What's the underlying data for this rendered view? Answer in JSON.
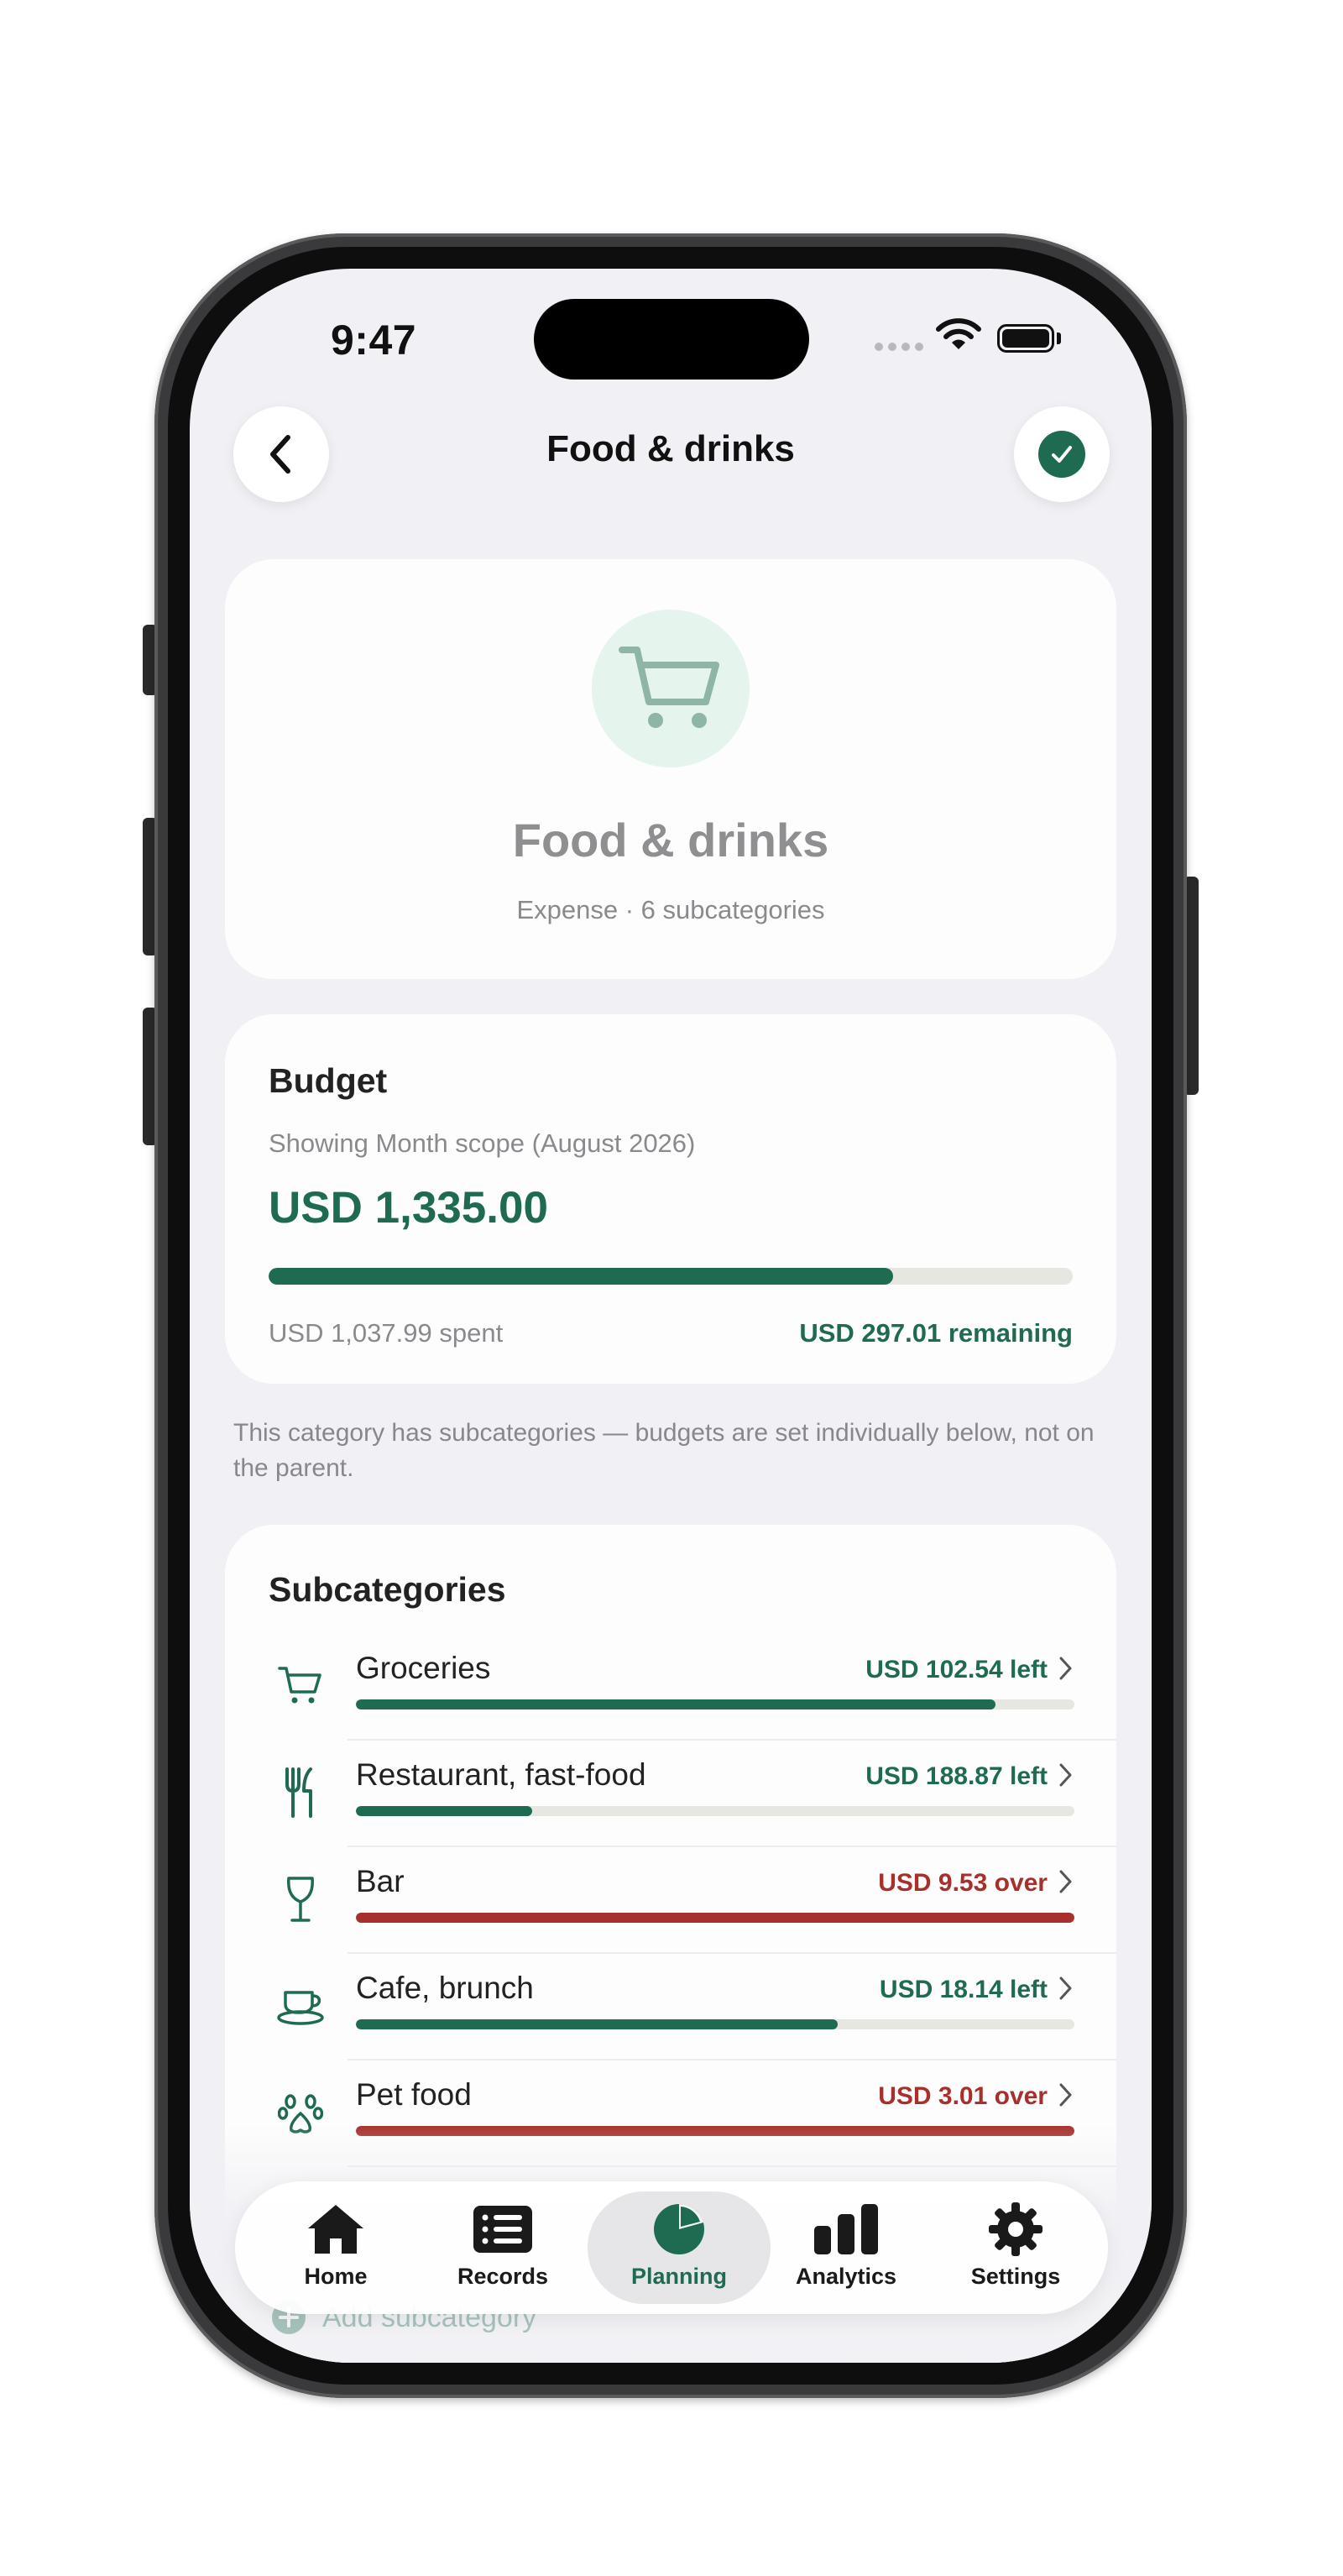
{
  "status_bar": {
    "time": "9:47"
  },
  "nav": {
    "title": "Food & drinks",
    "back_icon": "chevron-left-icon",
    "confirm_icon": "checkmark-icon"
  },
  "category": {
    "icon": "shopping-cart-icon",
    "name": "Food & drinks",
    "meta": "Expense · 6 subcategories"
  },
  "budget": {
    "title": "Budget",
    "scope": "Showing Month scope (August 2026)",
    "amount": "USD 1,335.00",
    "progress": 0.777,
    "spent": "USD 1,037.99 spent",
    "remaining": "USD 297.01 remaining"
  },
  "note": "This category has subcategories — budgets are set individually below, not on the parent.",
  "subcategories": {
    "title": "Subcategories",
    "items": [
      {
        "name": "Groceries",
        "icon": "shopping-cart-icon",
        "status": "USD 102.54 left",
        "state": "left",
        "progress": 0.89
      },
      {
        "name": "Restaurant, fast-food",
        "icon": "fork-knife-icon",
        "status": "USD 188.87 left",
        "state": "left",
        "progress": 0.245
      },
      {
        "name": "Bar",
        "icon": "wine-glass-icon",
        "status": "USD 9.53 over",
        "state": "over",
        "progress": 1.0
      },
      {
        "name": "Cafe, brunch",
        "icon": "coffee-cup-icon",
        "status": "USD 18.14 left",
        "state": "left",
        "progress": 0.67
      },
      {
        "name": "Pet food",
        "icon": "paw-icon",
        "status": "USD 3.01 over",
        "state": "over",
        "progress": 1.0
      }
    ],
    "add_label": "Add subcategory"
  },
  "tabbar": {
    "items": [
      {
        "label": "Home",
        "icon": "home-icon"
      },
      {
        "label": "Records",
        "icon": "list-icon"
      },
      {
        "label": "Planning",
        "icon": "pie-chart-icon",
        "active": true
      },
      {
        "label": "Analytics",
        "icon": "bar-chart-icon"
      },
      {
        "label": "Settings",
        "icon": "gear-icon"
      }
    ]
  },
  "colors": {
    "accent": "#1e6b52",
    "over": "#a8302c",
    "track": "#e7e7e2",
    "background": "#f1f1f5"
  }
}
